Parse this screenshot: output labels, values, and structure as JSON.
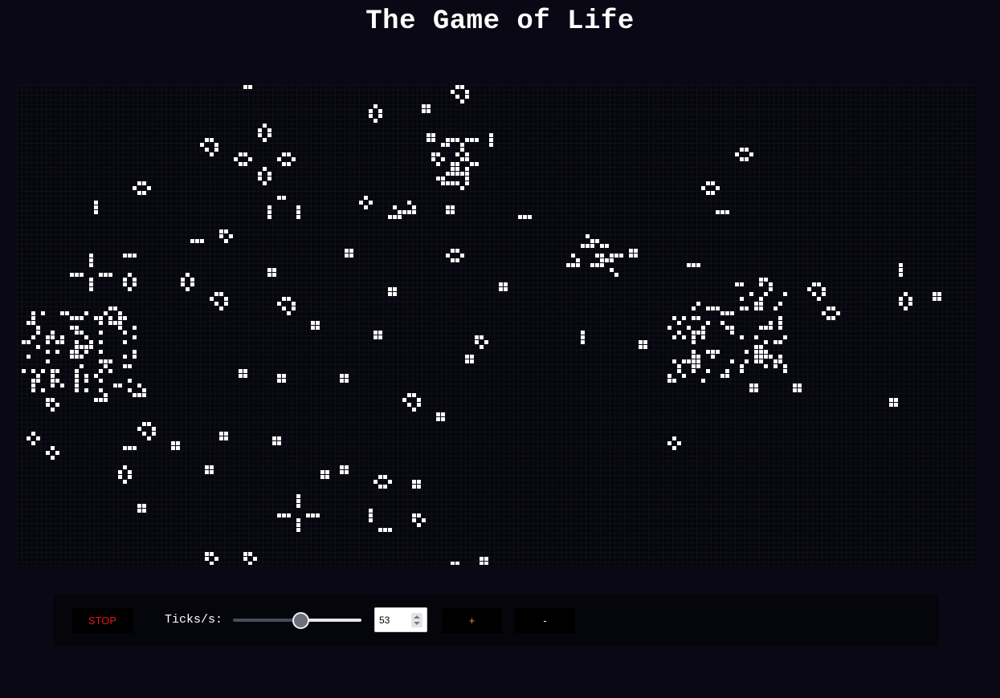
{
  "title": "The Game of Life",
  "controls": {
    "stop_label": "STOP",
    "ticks_label": "Ticks/s:",
    "ticks_value": "53",
    "slider_fraction": 0.525,
    "plus_label": "+",
    "minus_label": "-"
  },
  "colors": {
    "background": "#0a0815",
    "board": "#06060c",
    "grid_line": "#141926",
    "live_cell": "#ffffff",
    "stop_text": "#e01818",
    "plus_text": "#e88a2a",
    "minus_text": "#ffffff"
  }
}
